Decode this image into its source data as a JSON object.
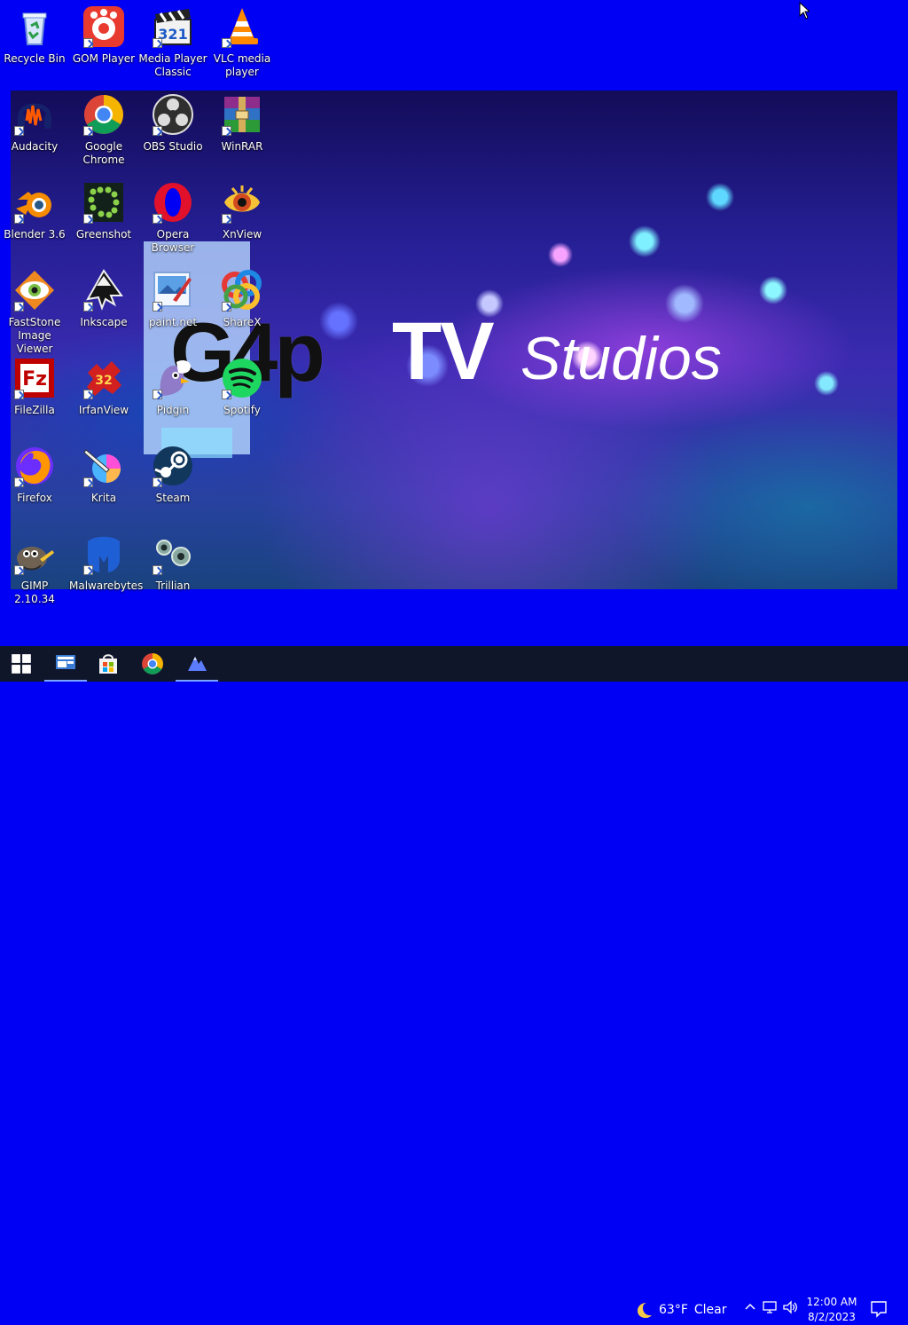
{
  "desktop": {
    "icons": [
      {
        "name": "recycle-bin",
        "label": "Recycle Bin",
        "icon": "recycle-bin-icon",
        "shortcut": false
      },
      {
        "name": "gom-player",
        "label": "GOM Player",
        "icon": "gom-player-icon",
        "shortcut": true
      },
      {
        "name": "media-player-classic",
        "label": "Media Player\nClassic",
        "icon": "media-player-classic-icon",
        "shortcut": true
      },
      {
        "name": "vlc-media-player",
        "label": "VLC media\nplayer",
        "icon": "vlc-icon",
        "shortcut": true
      },
      {
        "name": "audacity",
        "label": "Audacity",
        "icon": "audacity-icon",
        "shortcut": true
      },
      {
        "name": "google-chrome",
        "label": "Google\nChrome",
        "icon": "chrome-icon",
        "shortcut": true
      },
      {
        "name": "obs-studio",
        "label": "OBS Studio",
        "icon": "obs-icon",
        "shortcut": true
      },
      {
        "name": "winrar",
        "label": "WinRAR",
        "icon": "winrar-icon",
        "shortcut": true
      },
      {
        "name": "blender",
        "label": "Blender 3.6",
        "icon": "blender-icon",
        "shortcut": true
      },
      {
        "name": "greenshot",
        "label": "Greenshot",
        "icon": "greenshot-icon",
        "shortcut": true
      },
      {
        "name": "opera-browser",
        "label": "Opera\nBrowser",
        "icon": "opera-icon",
        "shortcut": true
      },
      {
        "name": "xnview",
        "label": "XnView",
        "icon": "xnview-icon",
        "shortcut": true
      },
      {
        "name": "faststone-image-viewer",
        "label": "FastStone\nImage Viewer",
        "icon": "faststone-icon",
        "shortcut": true
      },
      {
        "name": "inkscape",
        "label": "Inkscape",
        "icon": "inkscape-icon",
        "shortcut": true
      },
      {
        "name": "paint-net",
        "label": "paint.net",
        "icon": "paintnet-icon",
        "shortcut": true
      },
      {
        "name": "sharex",
        "label": "ShareX",
        "icon": "sharex-icon",
        "shortcut": true
      },
      {
        "name": "filezilla",
        "label": "FileZilla",
        "icon": "filezilla-icon",
        "shortcut": true
      },
      {
        "name": "irfanview",
        "label": "IrfanView",
        "icon": "irfanview-icon",
        "shortcut": true
      },
      {
        "name": "pidgin",
        "label": "Pidgin",
        "icon": "pidgin-icon",
        "shortcut": true
      },
      {
        "name": "spotify",
        "label": "Spotify",
        "icon": "spotify-icon",
        "shortcut": true
      },
      {
        "name": "firefox",
        "label": "Firefox",
        "icon": "firefox-icon",
        "shortcut": true
      },
      {
        "name": "krita",
        "label": "Krita",
        "icon": "krita-icon",
        "shortcut": true
      },
      {
        "name": "steam",
        "label": "Steam",
        "icon": "steam-icon",
        "shortcut": true
      },
      {
        "name": "gimp",
        "label": "GIMP 2.10.34",
        "icon": "gimp-icon",
        "shortcut": true
      },
      {
        "name": "malwarebytes",
        "label": "Malwarebytes",
        "icon": "malwarebytes-icon",
        "shortcut": true
      },
      {
        "name": "trillian",
        "label": "Trillian",
        "icon": "trillian-icon",
        "shortcut": true
      }
    ]
  },
  "wallpaper": {
    "logo_main": "G4p",
    "logo_tv": "TV",
    "logo_studios": "Studios"
  },
  "taskbar": {
    "apps": [
      {
        "name": "start-button",
        "icon": "windows-logo-icon"
      },
      {
        "name": "taskbar-app-1",
        "icon": "app-window-icon"
      },
      {
        "name": "taskbar-app-store",
        "icon": "microsoft-store-icon"
      },
      {
        "name": "taskbar-app-chrome",
        "icon": "chrome-icon"
      },
      {
        "name": "taskbar-app-mountain",
        "icon": "mountain-app-icon"
      }
    ],
    "weather": {
      "temp": "63°F",
      "condition": "Clear",
      "icon": "moon-icon"
    },
    "clock": {
      "time": "12:00 AM",
      "date": "8/2/2023"
    },
    "tray_icons": [
      "chevron-up-icon",
      "network-icon",
      "volume-icon"
    ],
    "notification_icon": "notification-icon"
  },
  "colors": {
    "desktop_bg": "#0000f4",
    "taskbar_bg": "#101629"
  }
}
